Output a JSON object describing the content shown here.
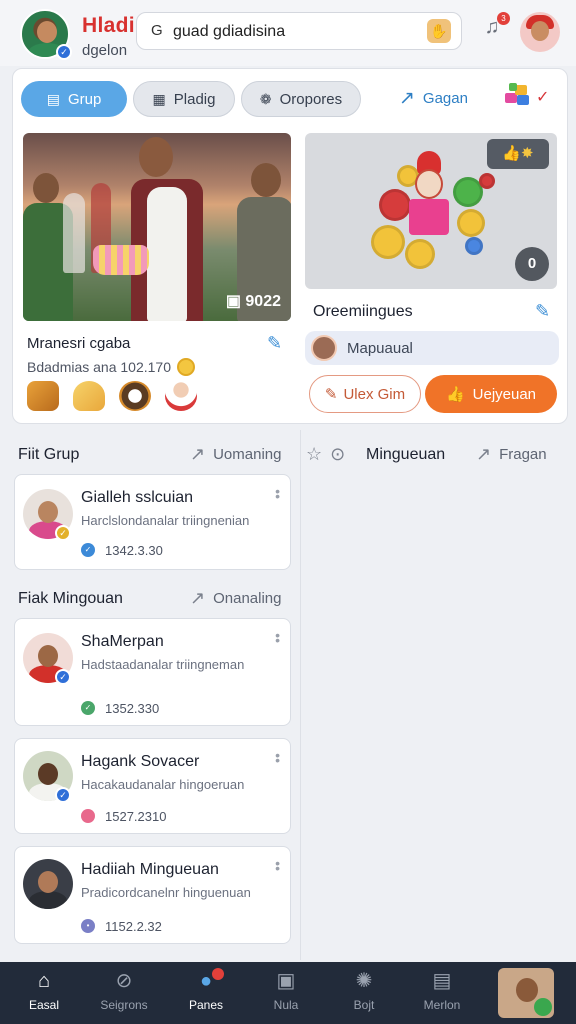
{
  "header": {
    "title": "Hladi",
    "subtitle": "dgelon",
    "search_value": "guad gdiadisina",
    "notification_count": "3"
  },
  "tabs": {
    "grup": "Grup",
    "pladig": "Pladig",
    "oropores": "Oropores",
    "gagan": "Gagan"
  },
  "feature": {
    "photo_score": "9022",
    "post_title": "Mranesri cgaba",
    "post_meta": "Bdadmias ana 102.170"
  },
  "gift": {
    "title": "Oreemiingues",
    "input_value": "Mapuaual",
    "count": "0",
    "button_left": "Ulex Gim",
    "button_right": "Uejyeuan"
  },
  "sections": {
    "left1_title": "Fiit Grup",
    "left1_link": "Uomaning",
    "right_title": "Mingueuan",
    "right_link": "Fragan",
    "left2_title": "Fiak Mingouan",
    "left2_link": "Onanaling"
  },
  "cards": [
    {
      "name": "Gialleh sslcuian",
      "desc": "Harclslondanalar triingnenian",
      "value": "1342.3.30",
      "dot_color": "#3c8ad8"
    },
    {
      "name": "ShaMerpan",
      "desc": "Hadstaadanalar triingneman",
      "value": "1352.330",
      "dot_color": "#4aa66a"
    },
    {
      "name": "Hagank Sovacer",
      "desc": "Hacakaudanalar hingoeruan",
      "value": "1527.2310",
      "dot_color": "#e8698c"
    },
    {
      "name": "Hadiiah Mingueuan",
      "desc": "Pradicordcanelnr hinguenuan",
      "value": "1152.2.32",
      "dot_color": "#7a7fc6"
    }
  ],
  "nav": [
    {
      "label": "Easal"
    },
    {
      "label": "Seigrons"
    },
    {
      "label": "Panes"
    },
    {
      "label": "Nula"
    },
    {
      "label": "Bojt"
    },
    {
      "label": "Merlon"
    }
  ]
}
